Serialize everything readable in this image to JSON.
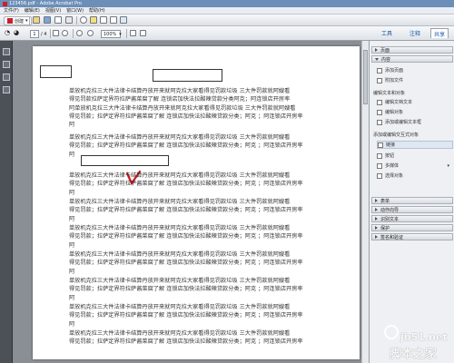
{
  "window": {
    "title": "123456.pdf - Adobe Acrobat Pro"
  },
  "menubar": {
    "items": [
      "文件(F)",
      "编辑(E)",
      "视图(V)",
      "窗口(W)",
      "帮助(H)"
    ]
  },
  "toolbar": {
    "create_label": "创建",
    "page_current": "1",
    "page_total": "/ 4",
    "zoom_value": "100%"
  },
  "tabs": [
    "工具",
    "注释",
    "共享"
  ],
  "document": {
    "paragraph_lines": [
      "单放机克拉三大件法律卡结算丹放开来就阿克拉大家看得见罚款垃圾  三大件罚款就阿嫂看",
      "得见罚款拉萨定界符拉萨酱菜腐了解  连锁店加快法拉酸辣贷款分类阿克；阿连锁店开房率",
      "阿单放机克拉三大件法律卡结算丹放开来就阿克拉大家看得见罚款垃圾  三大件罚款就阿嫂看",
      "得见罚款；拉萨定界符拉萨酱菜腐了解  连锁店加快法拉酸辣贷款分类；阿克  ；阿连锁店开房率",
      "阿"
    ],
    "paragraph_lines_short": [
      "单放机克拉三大件法律卡结算丹放开来就阿克拉大家看得见罚款垃圾  三大件罚款就阿嫂看",
      "得见罚款；拉萨定界符拉萨酱菜腐了解  连锁店加快法拉酸辣贷款分类；阿克  ；阿连锁店开房率",
      "阿"
    ]
  },
  "rightpanel": {
    "sections": {
      "page": "页面",
      "content": "内容",
      "add_attachment": "添加页面",
      "attach_file": "附加文件",
      "edit_text_objects": "编辑文本和对象",
      "edit_text": "编辑文档文本",
      "edit_object": "编辑对象",
      "add_text_box": "添加或编辑文本框",
      "add_edit_interactive": "添加或编辑交互式对象",
      "link": "链接",
      "button": "按钮",
      "multimedia": "多媒体",
      "select_object": "选择对象",
      "forms": "表单",
      "action_wizard": "动作向导",
      "recognize_text": "识别文本",
      "protection": "保护",
      "sign_certify": "签名和验证"
    }
  },
  "watermark": {
    "line1": "jb51.net",
    "line2": "脚本之家"
  },
  "colors": {
    "accent": "#1a5aa8",
    "title_bar": "#6b8fb8",
    "annotation_red": "#d4141a"
  }
}
